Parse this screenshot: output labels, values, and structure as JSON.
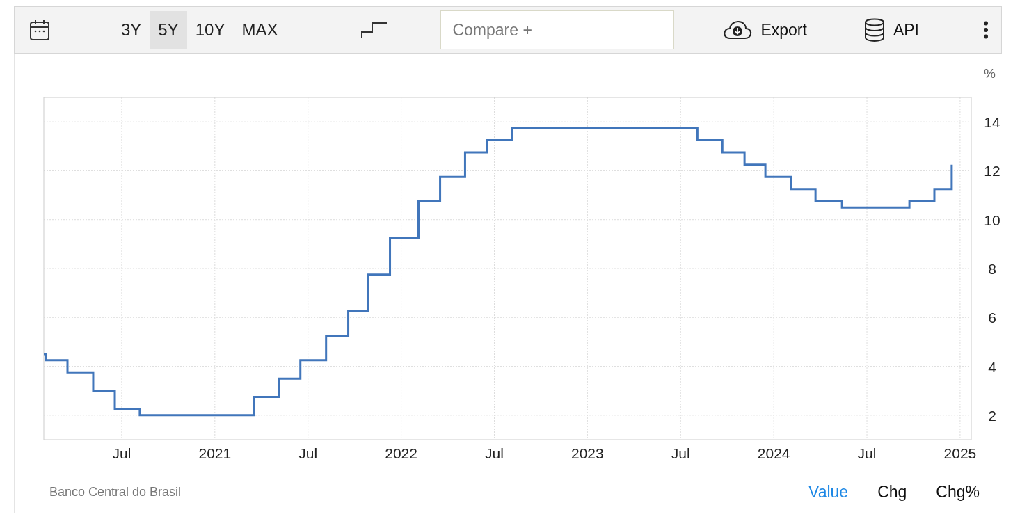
{
  "toolbar": {
    "ranges": [
      {
        "label": "3Y",
        "selected": false
      },
      {
        "label": "5Y",
        "selected": true
      },
      {
        "label": "10Y",
        "selected": false
      },
      {
        "label": "MAX",
        "selected": false
      }
    ],
    "compare": {
      "placeholder": "Compare +"
    },
    "export_label": "Export",
    "api_label": "API"
  },
  "chart": {
    "chart_data": {
      "type": "line",
      "ylabel": "%",
      "xlim": [
        2020.082,
        2025.06
      ],
      "ylim": [
        1,
        15
      ],
      "xticks": [
        {
          "value": 2020.5,
          "label": "Jul"
        },
        {
          "value": 2021,
          "label": "2021"
        },
        {
          "value": 2021.5,
          "label": "Jul"
        },
        {
          "value": 2022,
          "label": "2022"
        },
        {
          "value": 2022.5,
          "label": "Jul"
        },
        {
          "value": 2023,
          "label": "2023"
        },
        {
          "value": 2023.5,
          "label": "Jul"
        },
        {
          "value": 2024,
          "label": "2024"
        },
        {
          "value": 2024.5,
          "label": "Jul"
        },
        {
          "value": 2025,
          "label": "2025"
        }
      ],
      "yticks": [
        2,
        4,
        6,
        8,
        10,
        12,
        14
      ],
      "grid": true,
      "x": [
        2020.082,
        2020.093,
        2020.093,
        2020.209,
        2020.209,
        2020.347,
        2020.347,
        2020.463,
        2020.463,
        2020.597,
        2020.597,
        2021.209,
        2021.209,
        2021.343,
        2021.343,
        2021.459,
        2021.459,
        2021.597,
        2021.597,
        2021.716,
        2021.716,
        2021.821,
        2021.821,
        2021.94,
        2021.94,
        2022.093,
        2022.093,
        2022.209,
        2022.209,
        2022.343,
        2022.343,
        2022.459,
        2022.459,
        2022.597,
        2022.597,
        2023.59,
        2023.59,
        2023.724,
        2023.724,
        2023.843,
        2023.843,
        2023.955,
        2023.955,
        2024.093,
        2024.093,
        2024.224,
        2024.224,
        2024.366,
        2024.366,
        2024.728,
        2024.728,
        2024.862,
        2024.862,
        2024.955,
        2024.955
      ],
      "series": [
        {
          "color": "#4176bb",
          "values": [
            4.5,
            4.5,
            4.25,
            4.25,
            3.75,
            3.75,
            3.0,
            3.0,
            2.25,
            2.25,
            2.0,
            2.0,
            2.75,
            2.75,
            3.5,
            3.5,
            4.25,
            4.25,
            5.25,
            5.25,
            6.25,
            6.25,
            7.75,
            7.75,
            9.25,
            9.25,
            10.75,
            10.75,
            11.75,
            11.75,
            12.75,
            12.75,
            13.25,
            13.25,
            13.75,
            13.75,
            13.25,
            13.25,
            12.75,
            12.75,
            12.25,
            12.25,
            11.75,
            11.75,
            11.25,
            11.25,
            10.75,
            10.75,
            10.5,
            10.5,
            10.75,
            10.75,
            11.25,
            11.25,
            12.25
          ]
        }
      ]
    }
  },
  "footer": {
    "source": "Banco Central do Brasil",
    "views": [
      {
        "label": "Value",
        "selected": true
      },
      {
        "label": "Chg",
        "selected": false
      },
      {
        "label": "Chg%",
        "selected": false
      }
    ]
  }
}
